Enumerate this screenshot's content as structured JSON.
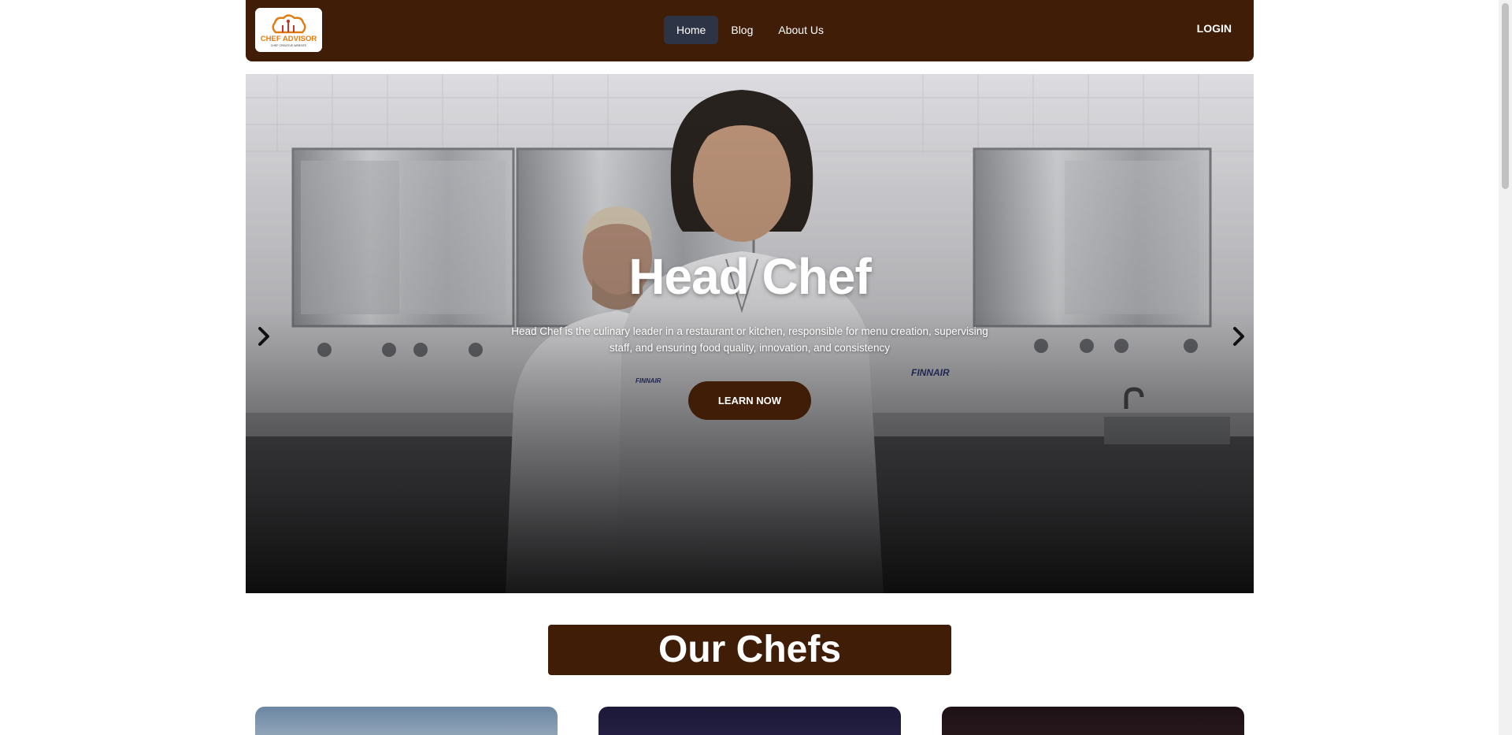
{
  "navbar": {
    "logo": {
      "text": "CHEF ADVISOR",
      "tagline": "CHEF CREATIVE WEBSITE",
      "icon": "chef-hat-icon"
    },
    "links": [
      {
        "label": "Home",
        "active": true
      },
      {
        "label": "Blog",
        "active": false
      },
      {
        "label": "About Us",
        "active": false
      }
    ],
    "login_label": "LOGIN"
  },
  "hero": {
    "title": "Head Chef",
    "description": "Head Chef is the culinary leader in a restaurant or kitchen, responsible for menu creation, supervising staff, and ensuring food quality, innovation, and consistency",
    "button_label": "LEARN NOW",
    "prev_icon": "chevron-left-icon",
    "next_icon": "chevron-right-icon"
  },
  "chefs_section": {
    "heading": "Our Chefs"
  },
  "colors": {
    "brand_brown": "#3f1d07",
    "active_nav": "#2d3445",
    "logo_orange": "#e07b12"
  }
}
